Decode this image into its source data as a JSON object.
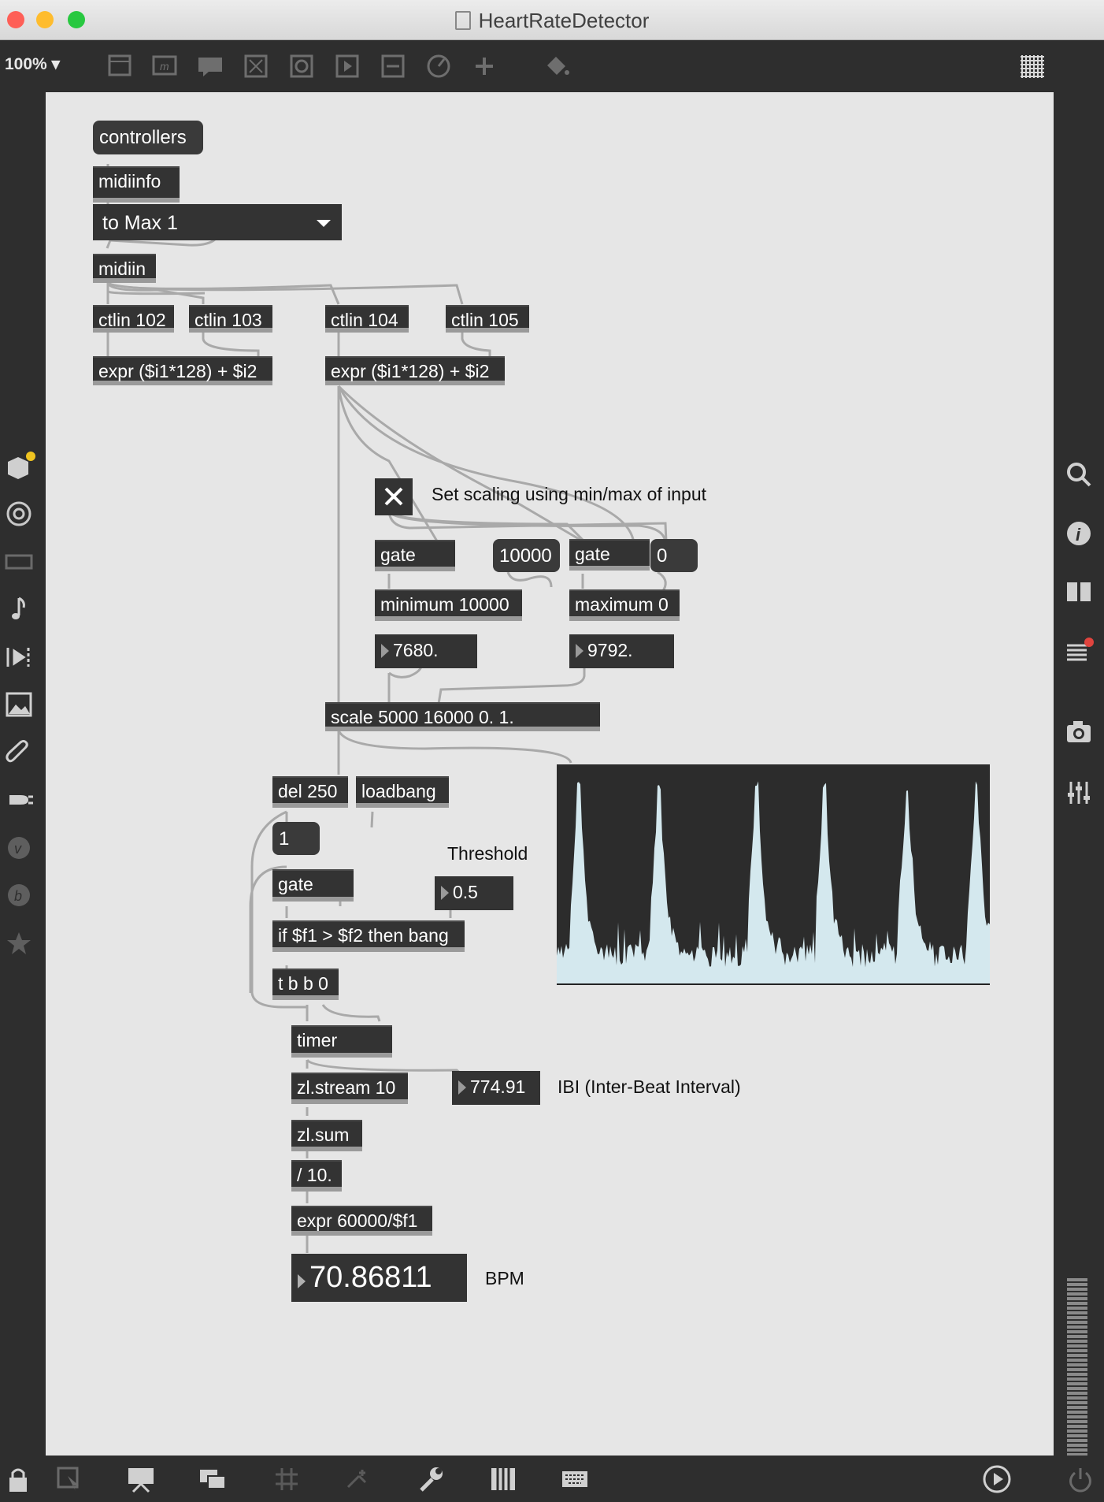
{
  "window": {
    "title": "HeartRateDetector"
  },
  "toolbar": {
    "zoom_label": "100% ▾",
    "icons": [
      "presentation-icon",
      "object-icon",
      "comment-icon",
      "toggle-icon",
      "button-icon",
      "play-icon",
      "slider-icon",
      "dial-icon",
      "add-icon",
      "paint-bucket-icon",
      "grid-icon"
    ]
  },
  "left_sidebar": {
    "icons": [
      "package-icon",
      "browse-icon",
      "media-icon",
      "music-icon",
      "video-icon",
      "image-icon",
      "attach-icon",
      "plug-icon",
      "vst-icon",
      "b-icon",
      "favorites-icon"
    ]
  },
  "right_sidebar": {
    "icons": [
      "search-icon",
      "info-icon",
      "columns-icon",
      "list-icon",
      "snapshot-icon",
      "mixer-icon"
    ]
  },
  "bottom_bar": {
    "icons": [
      "lock-icon",
      "select-icon",
      "presentation-icon",
      "windows-icon",
      "grid-icon",
      "snap-icon",
      "wrench-icon",
      "piano-icon",
      "keyboard-icon",
      "transport-icon",
      "power-icon"
    ]
  },
  "patch": {
    "controllers_msg": "controllers",
    "midiinfo": "midiinfo",
    "port_menu": "to Max 1",
    "midiin": "midiin",
    "ctlin_102": "ctlin 102",
    "ctlin_103": "ctlin 103",
    "ctlin_104": "ctlin 104",
    "ctlin_105": "ctlin 105",
    "expr_left": "expr ($i1*128) + $i2",
    "expr_right": "expr ($i1*128) + $i2",
    "scaling_comment": "Set scaling using min/max of input",
    "gate_min": "gate",
    "msg_10000": "10000",
    "gate_max": "gate",
    "msg_0": "0",
    "minimum": "minimum 10000",
    "maximum": "maximum 0",
    "min_value": "7680.",
    "max_value": "9792.",
    "scale": "scale 5000 16000 0. 1.",
    "del": "del 250",
    "loadbang": "loadbang",
    "msg_1": "1",
    "threshold_comment": "Threshold",
    "gate_main": "gate",
    "threshold_value": "0.5",
    "if_obj": "if $f1 > $f2 then bang",
    "trigger": "t b b 0",
    "timer": "timer",
    "zl_stream": "zl.stream 10",
    "ibi_value": "774.91",
    "ibi_comment": "IBI (Inter-Beat Interval)",
    "zl_sum": "zl.sum",
    "divide": "/ 10.",
    "expr_bpm": "expr 60000/$f1",
    "bpm_value": "70.86811",
    "bpm_comment": "BPM"
  },
  "colors": {
    "canvas": "#e6e6e6",
    "object": "#333333",
    "scope_fill": "#d4e8ee",
    "cord": "#a9a9a9"
  }
}
